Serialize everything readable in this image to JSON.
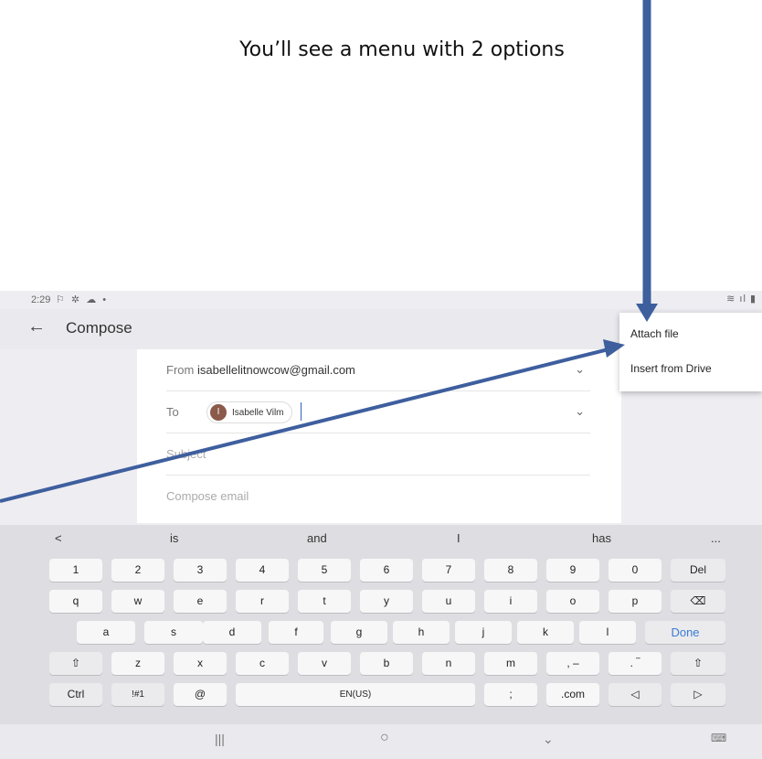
{
  "caption": "You’ll see a menu with 2 options",
  "status_bar": {
    "time": "2:29",
    "left_icons": "⚐ ✲ ☁ •",
    "right_icons": "≋ ıl ▮"
  },
  "app_bar": {
    "title": "Compose"
  },
  "compose": {
    "from_label": "From",
    "from_value": "isabellelitnowcow@gmail.com",
    "to_label": "To",
    "recipient_initial": "I",
    "recipient_name": "Isabelle Vilm",
    "subject_placeholder": "Subject",
    "body_placeholder": "Compose email"
  },
  "menu": {
    "items": [
      "Attach file",
      "Insert from Drive"
    ]
  },
  "keyboard": {
    "suggestions": [
      "<",
      "is",
      "and",
      "I",
      "has",
      "..."
    ],
    "number_row": [
      "1",
      "2",
      "3",
      "4",
      "5",
      "6",
      "7",
      "8",
      "9",
      "0",
      "Del"
    ],
    "q_row": [
      "q",
      "w",
      "e",
      "r",
      "t",
      "y",
      "u",
      "i",
      "o",
      "p",
      "⌫"
    ],
    "a_row": [
      "a",
      "s",
      "d",
      "f",
      "g",
      "h",
      "j",
      "k",
      "l",
      "Done"
    ],
    "z_row": [
      "⇧",
      "z",
      "x",
      "c",
      "v",
      "b",
      "n",
      "m",
      ", –",
      ". ‾",
      "⇧"
    ],
    "bottom_row": [
      "Ctrl",
      "!#1",
      "@",
      "EN(US)",
      ";",
      ".com",
      "◁",
      "▷"
    ]
  },
  "nav_bar": {
    "recent": "|||",
    "home": "○",
    "back": "⌄",
    "keyboard": "⌨"
  },
  "colors": {
    "arrow": "#3e5f9e",
    "accent": "#3b7bd8"
  }
}
